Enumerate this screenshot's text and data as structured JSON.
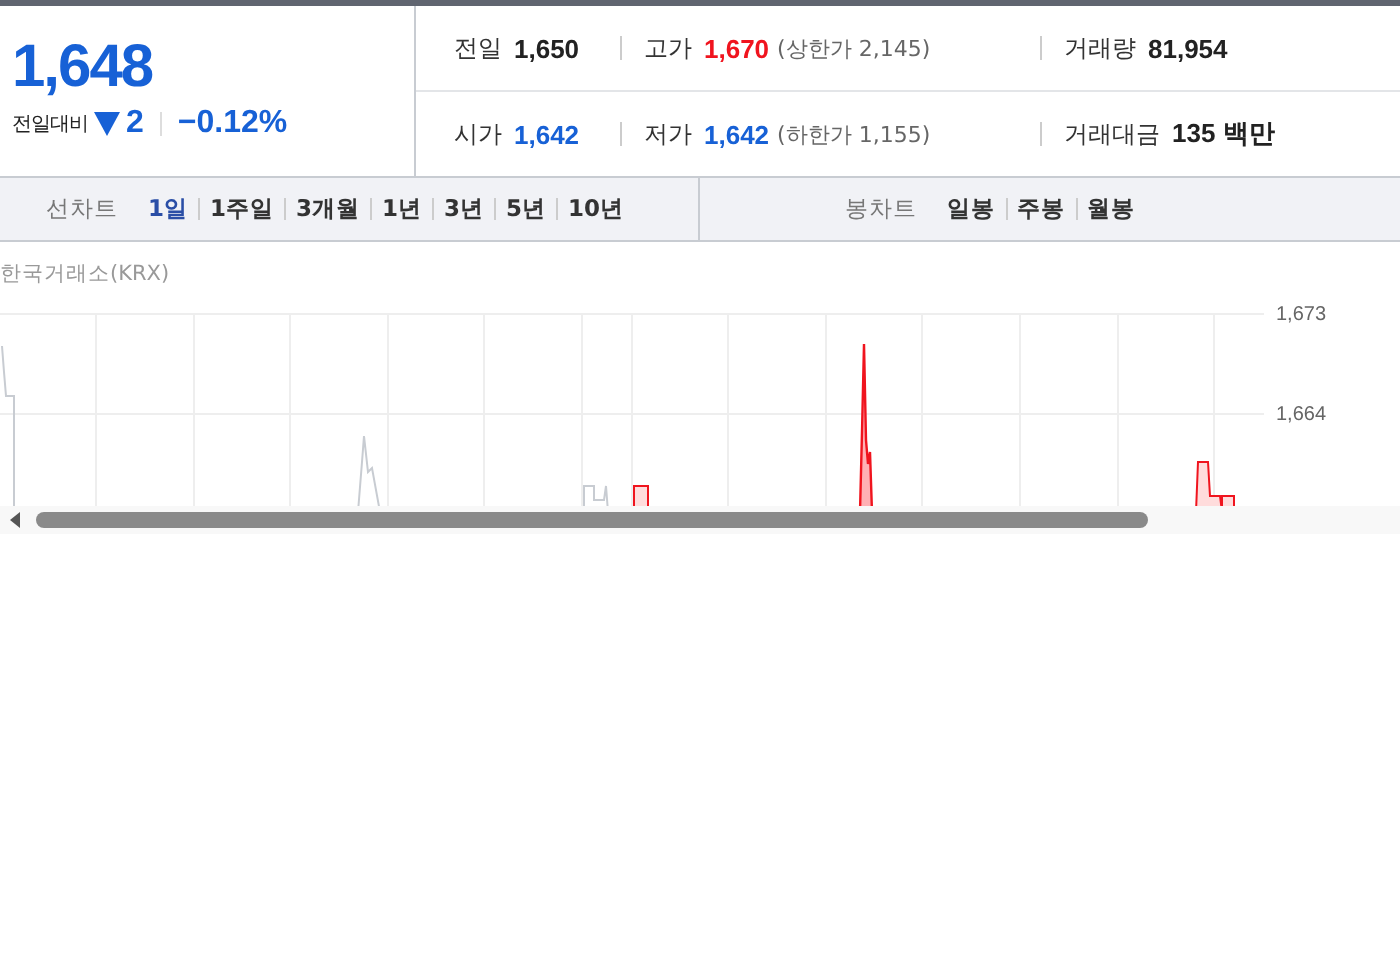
{
  "summary": {
    "price": "1,648",
    "change_label": "전일대비",
    "falling": true,
    "change": "2",
    "change_rate": "−0.12%"
  },
  "stats": [
    [
      {
        "label": "전일",
        "value": "1,650",
        "color": "#222222"
      },
      {
        "label": "고가",
        "value": "1,670",
        "color": "#f0141e",
        "note": "(상한가 2,145)"
      },
      {
        "label": "거래량",
        "value": "81,954",
        "color": "#222222"
      }
    ],
    [
      {
        "label": "시가",
        "value": "1,642",
        "color": "#1761d6"
      },
      {
        "label": "저가",
        "value": "1,642",
        "color": "#1761d6",
        "note": "(하한가 1,155)"
      },
      {
        "label": "거래대금",
        "value": "135 백만",
        "color": "#222222"
      }
    ]
  ],
  "line_chart": {
    "label": "선차트",
    "periods": [
      {
        "label": "1일",
        "selected": true
      },
      {
        "label": "1주일",
        "selected": false
      },
      {
        "label": "3개월",
        "selected": false
      },
      {
        "label": "1년",
        "selected": false
      },
      {
        "label": "3년",
        "selected": false
      },
      {
        "label": "5년",
        "selected": false
      },
      {
        "label": "10년",
        "selected": false
      }
    ]
  },
  "candle_chart": {
    "label": "봉차트",
    "periods": [
      {
        "label": "일봉",
        "selected": false
      },
      {
        "label": "주봉",
        "selected": false
      },
      {
        "label": "월봉",
        "selected": false
      }
    ]
  },
  "chart": {
    "source": "한국거래소(KRX)",
    "y_ticks": [
      "1,673",
      "1,664"
    ]
  }
}
